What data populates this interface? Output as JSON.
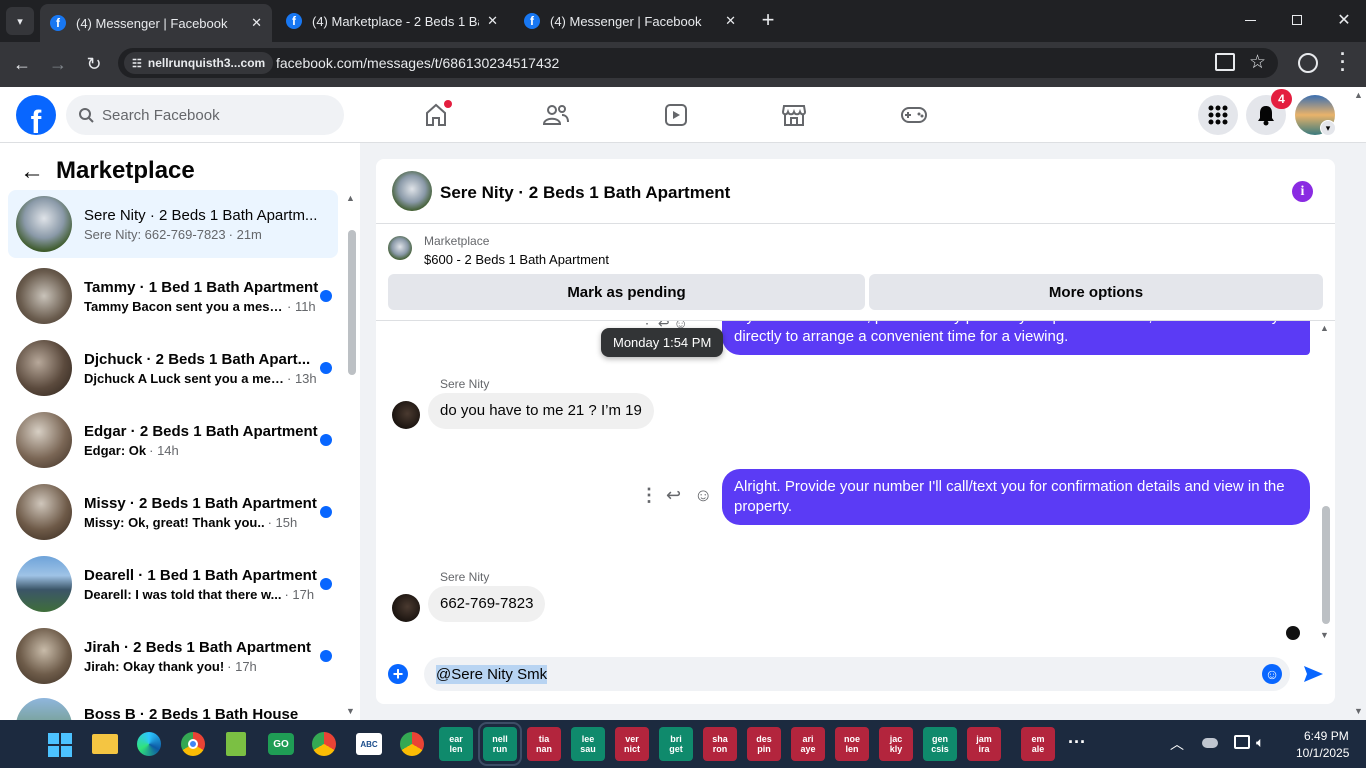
{
  "browser": {
    "tabs": [
      {
        "title": "(4) Messenger | Facebook",
        "active": true
      },
      {
        "title": "(4) Marketplace - 2 Beds 1 Bath",
        "active": false
      },
      {
        "title": "(4) Messenger | Facebook",
        "active": false
      }
    ],
    "site_chip": "nellrunquisth3...com",
    "url": "facebook.com/messages/t/686130234517432"
  },
  "fb": {
    "logo": "f",
    "search_placeholder": "Search Facebook",
    "notif_count": "4"
  },
  "left": {
    "title": "Marketplace",
    "conversations": [
      {
        "name": "Sere Nity · 2 Beds 1 Bath Apartm...",
        "preview": "Sere Nity: 662-769-7823",
        "time": "· 21m",
        "unread": false,
        "selected": true
      },
      {
        "name": "Tammy · 1 Bed 1 Bath Apartment",
        "preview": "Tammy Bacon sent you a mess...",
        "time": "· 11h",
        "unread": true
      },
      {
        "name": "Djchuck · 2 Beds 1 Bath Apart...",
        "preview": "Djchuck A Luck sent you a mes...",
        "time": "· 13h",
        "unread": true
      },
      {
        "name": "Edgar · 2 Beds 1 Bath Apartment",
        "preview": "Edgar: Ok",
        "time": "· 14h",
        "unread": true
      },
      {
        "name": "Missy · 2 Beds 1 Bath Apartment",
        "preview": "Missy: Ok, great! Thank you..",
        "time": "· 15h",
        "unread": true
      },
      {
        "name": "Dearell · 1 Bed 1 Bath Apartment",
        "preview": "Dearell: I was told that there w...",
        "time": "· 17h",
        "unread": true
      },
      {
        "name": "Jirah · 2 Beds 1 Bath Apartment",
        "preview": "Jirah: Okay thank you!",
        "time": "· 17h",
        "unread": true
      },
      {
        "name": "Boss B · 2 Beds 1 Bath House",
        "preview": "",
        "time": "",
        "unread": false
      }
    ]
  },
  "chat": {
    "title": "Sere Nity · 2 Beds 1 Bath Apartment",
    "listing_label": "Marketplace",
    "listing_title": "$600 - 2 Beds 1 Bath Apartment",
    "mark_pending": "Mark as pending",
    "more_options": "More options",
    "tooltip": "Monday 1:54 PM",
    "messages": [
      {
        "from": "me",
        "text": "If you are interested, please kindly provide your phone number, and I will contact you directly to arrange a convenient time for a viewing."
      },
      {
        "from": "them",
        "sender": "Sere Nity",
        "text": "do you have to me 21 ? I’m 19"
      },
      {
        "from": "me",
        "text": "Alright. Provide your number I'll call/text you for confirmation details and view in the property."
      },
      {
        "from": "them",
        "sender": "Sere Nity",
        "text": "662-769-7823"
      }
    ],
    "composer_value": "@Sere Nity Smk"
  },
  "taskbar": {
    "apps": [
      {
        "label": "ear\nlen",
        "color": "green"
      },
      {
        "label": "nell\nrun",
        "color": "green"
      },
      {
        "label": "tia\nnan",
        "color": "red"
      },
      {
        "label": "lee\nsau",
        "color": "green"
      },
      {
        "label": "ver\nnict",
        "color": "red"
      },
      {
        "label": "bri\nget",
        "color": "green"
      },
      {
        "label": "sha\nron",
        "color": "red"
      },
      {
        "label": "des\npin",
        "color": "red"
      },
      {
        "label": "ari\naye",
        "color": "red"
      },
      {
        "label": "noe\nlen",
        "color": "red"
      },
      {
        "label": "jac\nkly",
        "color": "red"
      },
      {
        "label": "gen\ncsis",
        "color": "green"
      },
      {
        "label": "jam\nira",
        "color": "red"
      },
      {
        "label": "em\nale",
        "color": "red"
      }
    ],
    "time": "6:49 PM",
    "date": "10/1/2025"
  }
}
